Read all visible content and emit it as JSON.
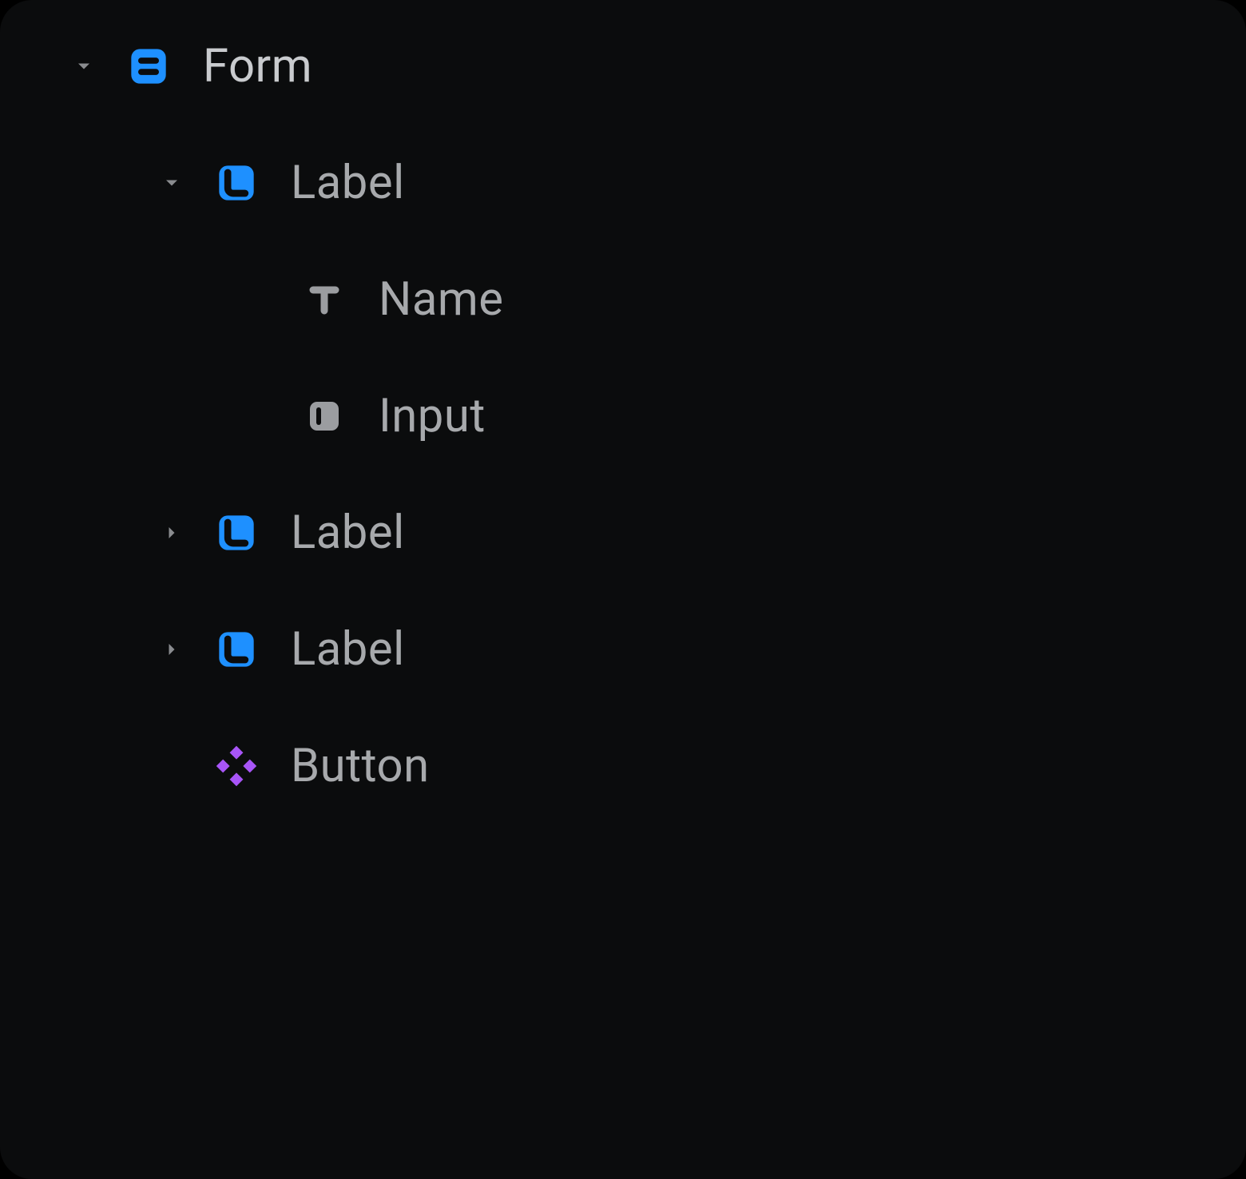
{
  "tree": {
    "root": {
      "label": "Form",
      "children": {
        "label1": {
          "label": "Label",
          "children": {
            "text1": {
              "label": "Name"
            },
            "input1": {
              "label": "Input"
            }
          }
        },
        "label2": {
          "label": "Label"
        },
        "label3": {
          "label": "Label"
        },
        "button1": {
          "label": "Button"
        }
      }
    }
  },
  "colors": {
    "accent_blue": "#1e90ff",
    "accent_purple": "#a855f7",
    "icon_gray": "#9b9da0",
    "text": "#a7a9ac"
  }
}
